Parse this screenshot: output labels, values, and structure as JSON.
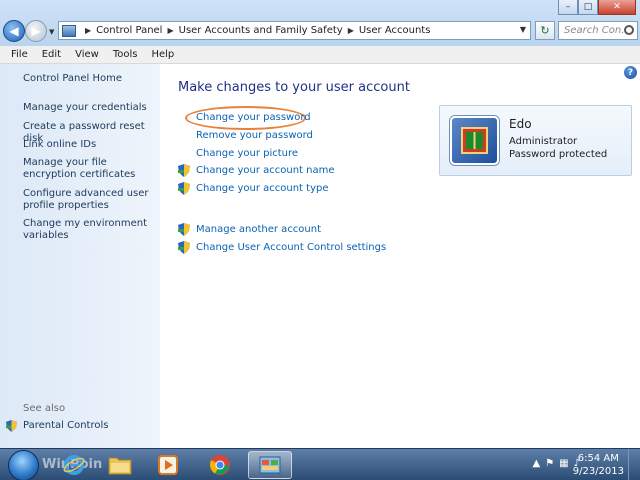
{
  "window": {
    "controls": {
      "minimize": "–",
      "maximize": "□",
      "close": "✕"
    }
  },
  "address": {
    "crumbs": [
      "Control Panel",
      "User Accounts and Family Safety",
      "User Accounts"
    ],
    "search_placeholder": "Search Con..."
  },
  "menu": [
    "File",
    "Edit",
    "View",
    "Tools",
    "Help"
  ],
  "sidebar": {
    "home": "Control Panel Home",
    "items": [
      "Manage your credentials",
      "Create a password reset disk",
      "Link online IDs",
      "Manage your file encryption certificates",
      "Configure advanced user profile properties",
      "Change my environment variables"
    ],
    "see_also": "See also",
    "parental_controls": "Parental Controls"
  },
  "main": {
    "heading": "Make changes to your user account",
    "tasks": [
      "Change your password",
      "Remove your password",
      "Change your picture",
      "Change your account name",
      "Change your account type"
    ],
    "other_tasks": [
      "Manage another account",
      "Change User Account Control settings"
    ],
    "highlight_color": "#e8823a",
    "link_color": "#0a63b3",
    "heading_color": "#1e3287"
  },
  "user": {
    "name": "Edo",
    "role": "Administrator",
    "status": "Password protected"
  },
  "taskbar": {
    "watermark": "WinPoin",
    "apps": [
      "internet-explorer-icon",
      "folder-icon",
      "media-player-icon",
      "chrome-icon",
      "control-panel-icon"
    ],
    "time": "6:54 AM",
    "date": "9/23/2013"
  }
}
